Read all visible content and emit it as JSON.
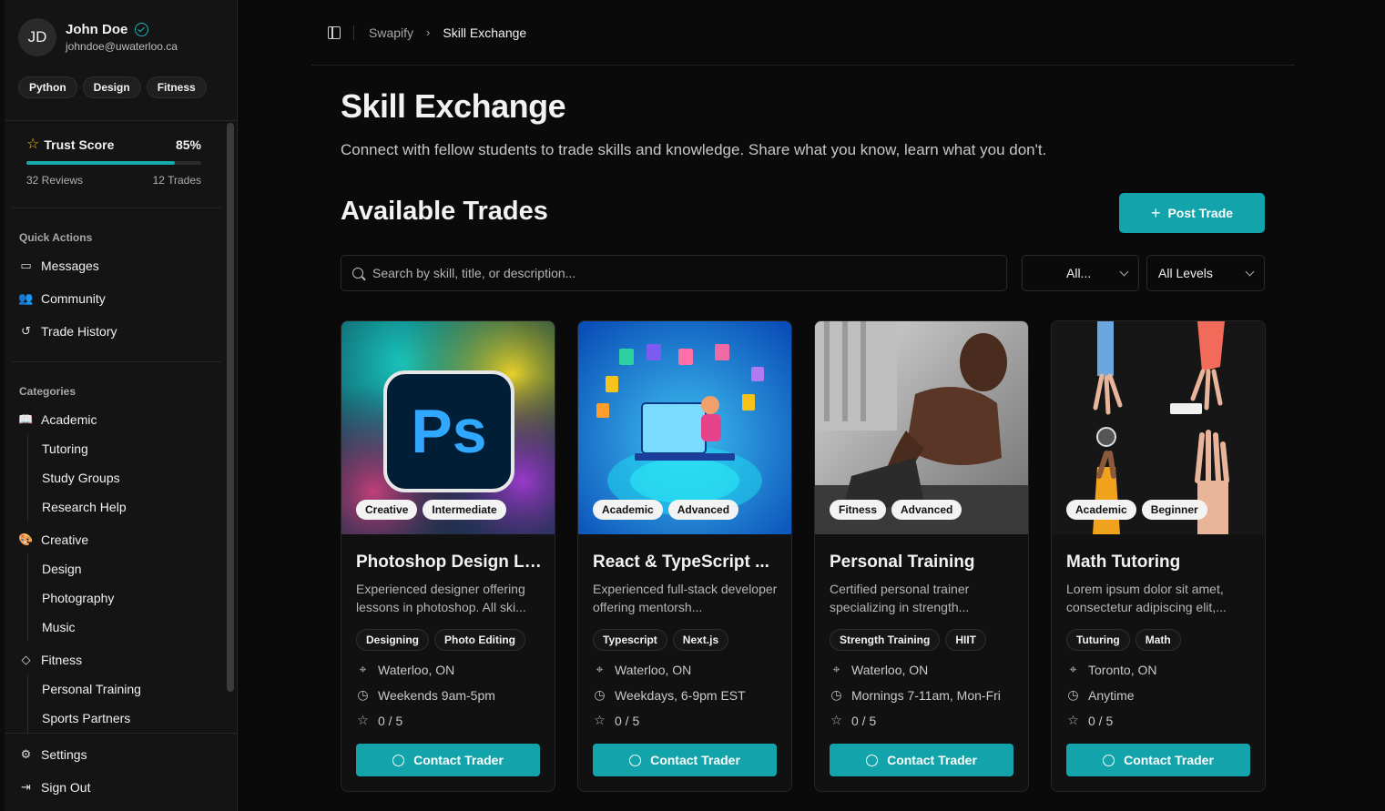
{
  "user": {
    "initials": "JD",
    "name": "John Doe",
    "email": "johndoe@uwaterloo.ca",
    "skills": [
      "Python",
      "Design",
      "Fitness"
    ]
  },
  "trust": {
    "label": "Trust Score",
    "percent_label": "85%",
    "percent_value": 0.85,
    "reviews": "32 Reviews",
    "trades": "12 Trades"
  },
  "quick_actions": {
    "label": "Quick Actions",
    "items": [
      "Messages",
      "Community",
      "Trade History"
    ]
  },
  "categories": {
    "label": "Categories",
    "groups": [
      {
        "name": "Academic",
        "icon": "book-open-icon",
        "subs": [
          "Tutoring",
          "Study Groups",
          "Research Help"
        ]
      },
      {
        "name": "Creative",
        "icon": "palette-icon",
        "subs": [
          "Design",
          "Photography",
          "Music"
        ]
      },
      {
        "name": "Fitness",
        "icon": "shapes-icon",
        "subs": [
          "Personal Training",
          "Sports Partners"
        ]
      }
    ]
  },
  "bottom_nav": [
    "Settings",
    "Sign Out"
  ],
  "breadcrumb": [
    "Swapify",
    "Skill Exchange"
  ],
  "page": {
    "title": "Skill Exchange",
    "subtitle": "Connect with fellow students to trade skills and knowledge. Share what you know, learn what you don't.",
    "section_title": "Available Trades",
    "post_button": "Post Trade",
    "search_placeholder": "Search by skill, title, or description...",
    "category_filter": "All...",
    "level_filter": "All Levels"
  },
  "cards": [
    {
      "badges": [
        "Creative",
        "Intermediate"
      ],
      "title": "Photoshop Design Le...",
      "desc": "Experienced designer offering lessons in photoshop. All ski...",
      "tags": [
        "Designing",
        "Photo Editing"
      ],
      "location": "Waterloo, ON",
      "schedule": "Weekends 9am-5pm",
      "rating": "0 / 5",
      "button": "Contact Trader",
      "logo_text": "Ps"
    },
    {
      "badges": [
        "Academic",
        "Advanced"
      ],
      "title": "React & TypeScript ...",
      "desc": "Experienced full-stack developer offering mentorsh...",
      "tags": [
        "Typescript",
        "Next.js"
      ],
      "location": "Waterloo, ON",
      "schedule": "Weekdays, 6-9pm EST",
      "rating": "0 / 5",
      "button": "Contact Trader"
    },
    {
      "badges": [
        "Fitness",
        "Advanced"
      ],
      "title": "Personal Training",
      "desc": "Certified personal trainer specializing in strength...",
      "tags": [
        "Strength Training",
        "HIIT"
      ],
      "location": "Waterloo, ON",
      "schedule": "Mornings 7-11am, Mon-Fri",
      "rating": "0 / 5",
      "button": "Contact Trader"
    },
    {
      "badges": [
        "Academic",
        "Beginner"
      ],
      "title": "Math Tutoring",
      "desc": "Lorem ipsum dolor sit amet, consectetur adipiscing elit,...",
      "tags": [
        "Tuturing",
        "Math"
      ],
      "location": "Toronto, ON",
      "schedule": "Anytime",
      "rating": "0 / 5",
      "button": "Contact Trader"
    }
  ],
  "colors": {
    "accent": "#13a3aa",
    "star": "#f2c200",
    "background": "#0a0a0a",
    "sidebar": "#141414"
  }
}
